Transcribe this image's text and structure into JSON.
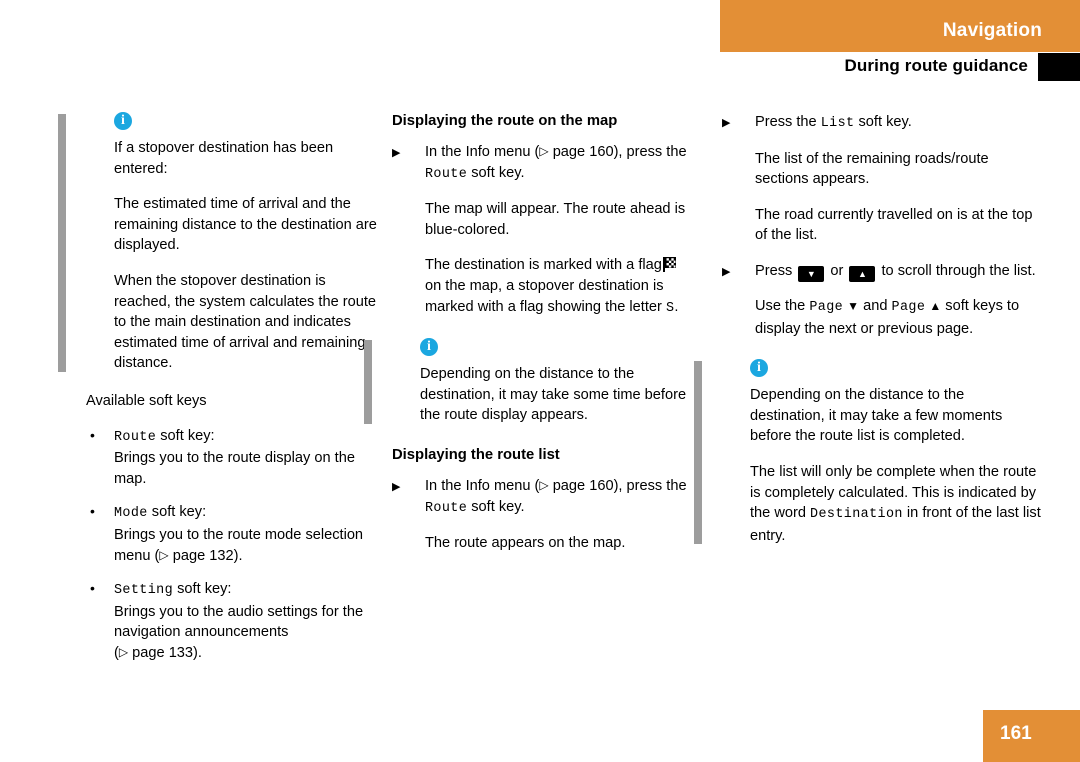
{
  "header": {
    "chapter": "Navigation",
    "section": "During route guidance"
  },
  "footer": {
    "page_number": "161"
  },
  "colors": {
    "accent_orange": "#e38f36",
    "note_bar_gray": "#9d9d9d",
    "info_blue": "#1ba7e0",
    "softkey_gray": "#555555"
  },
  "left_column": {
    "note": {
      "icon": "info-icon",
      "paragraphs": [
        "If a stopover destination has been entered:",
        "The estimated time of arrival and the remaining distance to the destination are displayed.",
        "When the stopover destination is reached, the system calculates the route to the main destination and indicates estimated time of arrival and remaining distance."
      ]
    },
    "softkeys_intro": "Available soft keys",
    "softkeys": [
      {
        "key": "Route",
        "suffix": " soft key:",
        "description": "Brings you to the route display on the map.",
        "pageref": ""
      },
      {
        "key": "Mode",
        "suffix": " soft key:",
        "description": "Brings you to the route mode selection menu (",
        "pageref": " page  132).",
        "pageref_text": "page  132"
      },
      {
        "key": "Setting",
        "suffix": " soft key:",
        "description": "Brings you to the audio settings for the navigation announcements",
        "pageref": " page  133).",
        "pageref_text": "page  133"
      }
    ]
  },
  "middle_column": {
    "heading_map": "Displaying the route on the map",
    "step_map": {
      "before": "In the Info menu (",
      "pageref": "page  160",
      "mid": "), press the ",
      "key": "Route",
      "after": " soft key."
    },
    "body_map": [
      "The map will appear. The route ahead is blue-colored.",
      "The destination is marked with a flag"
    ],
    "flag_sentence_rest": "on the map, a stopover destination is marked with a flag showing the letter",
    "flag_letter": "S",
    "flag_sentence_end": ".",
    "note": {
      "icon": "info-icon",
      "text": "Depending on the distance to the destination, it may take some time before the route display appears."
    },
    "heading_list": "Displaying the route list",
    "step_list": {
      "before": "In the Info menu (",
      "pageref": "page  160",
      "mid": "), press the ",
      "key": "Route",
      "after": " soft key."
    },
    "body_list": "The route appears on the map."
  },
  "right_column": {
    "step_press_list": {
      "before": "Press the ",
      "key": "List",
      "after": " soft key."
    },
    "body1": "The list of the remaining roads/route sections appears.",
    "body2": "The road currently travelled on is at the top of the list.",
    "step_scroll": {
      "before": "Press ",
      "key_down": "down-arrow-key",
      "mid": " or ",
      "key_up": "up-arrow-key",
      "after": " to scroll through the list."
    },
    "body3": {
      "before": "Use the ",
      "key1": "Page",
      "glyph1": "▼",
      "mid": " and ",
      "key2": "Page",
      "glyph2": "▲",
      "after": " soft keys to display the next or previous page."
    },
    "note": {
      "icon": "info-icon",
      "paragraphs": [
        "Depending on the distance to the destination, it may take a few moments before the route list is completed.",
        "The list will only be complete when the route is completely calculated. This is indicated by the word"
      ],
      "keyword": "Destination",
      "paragraph_end": "in front of the last list entry."
    }
  }
}
